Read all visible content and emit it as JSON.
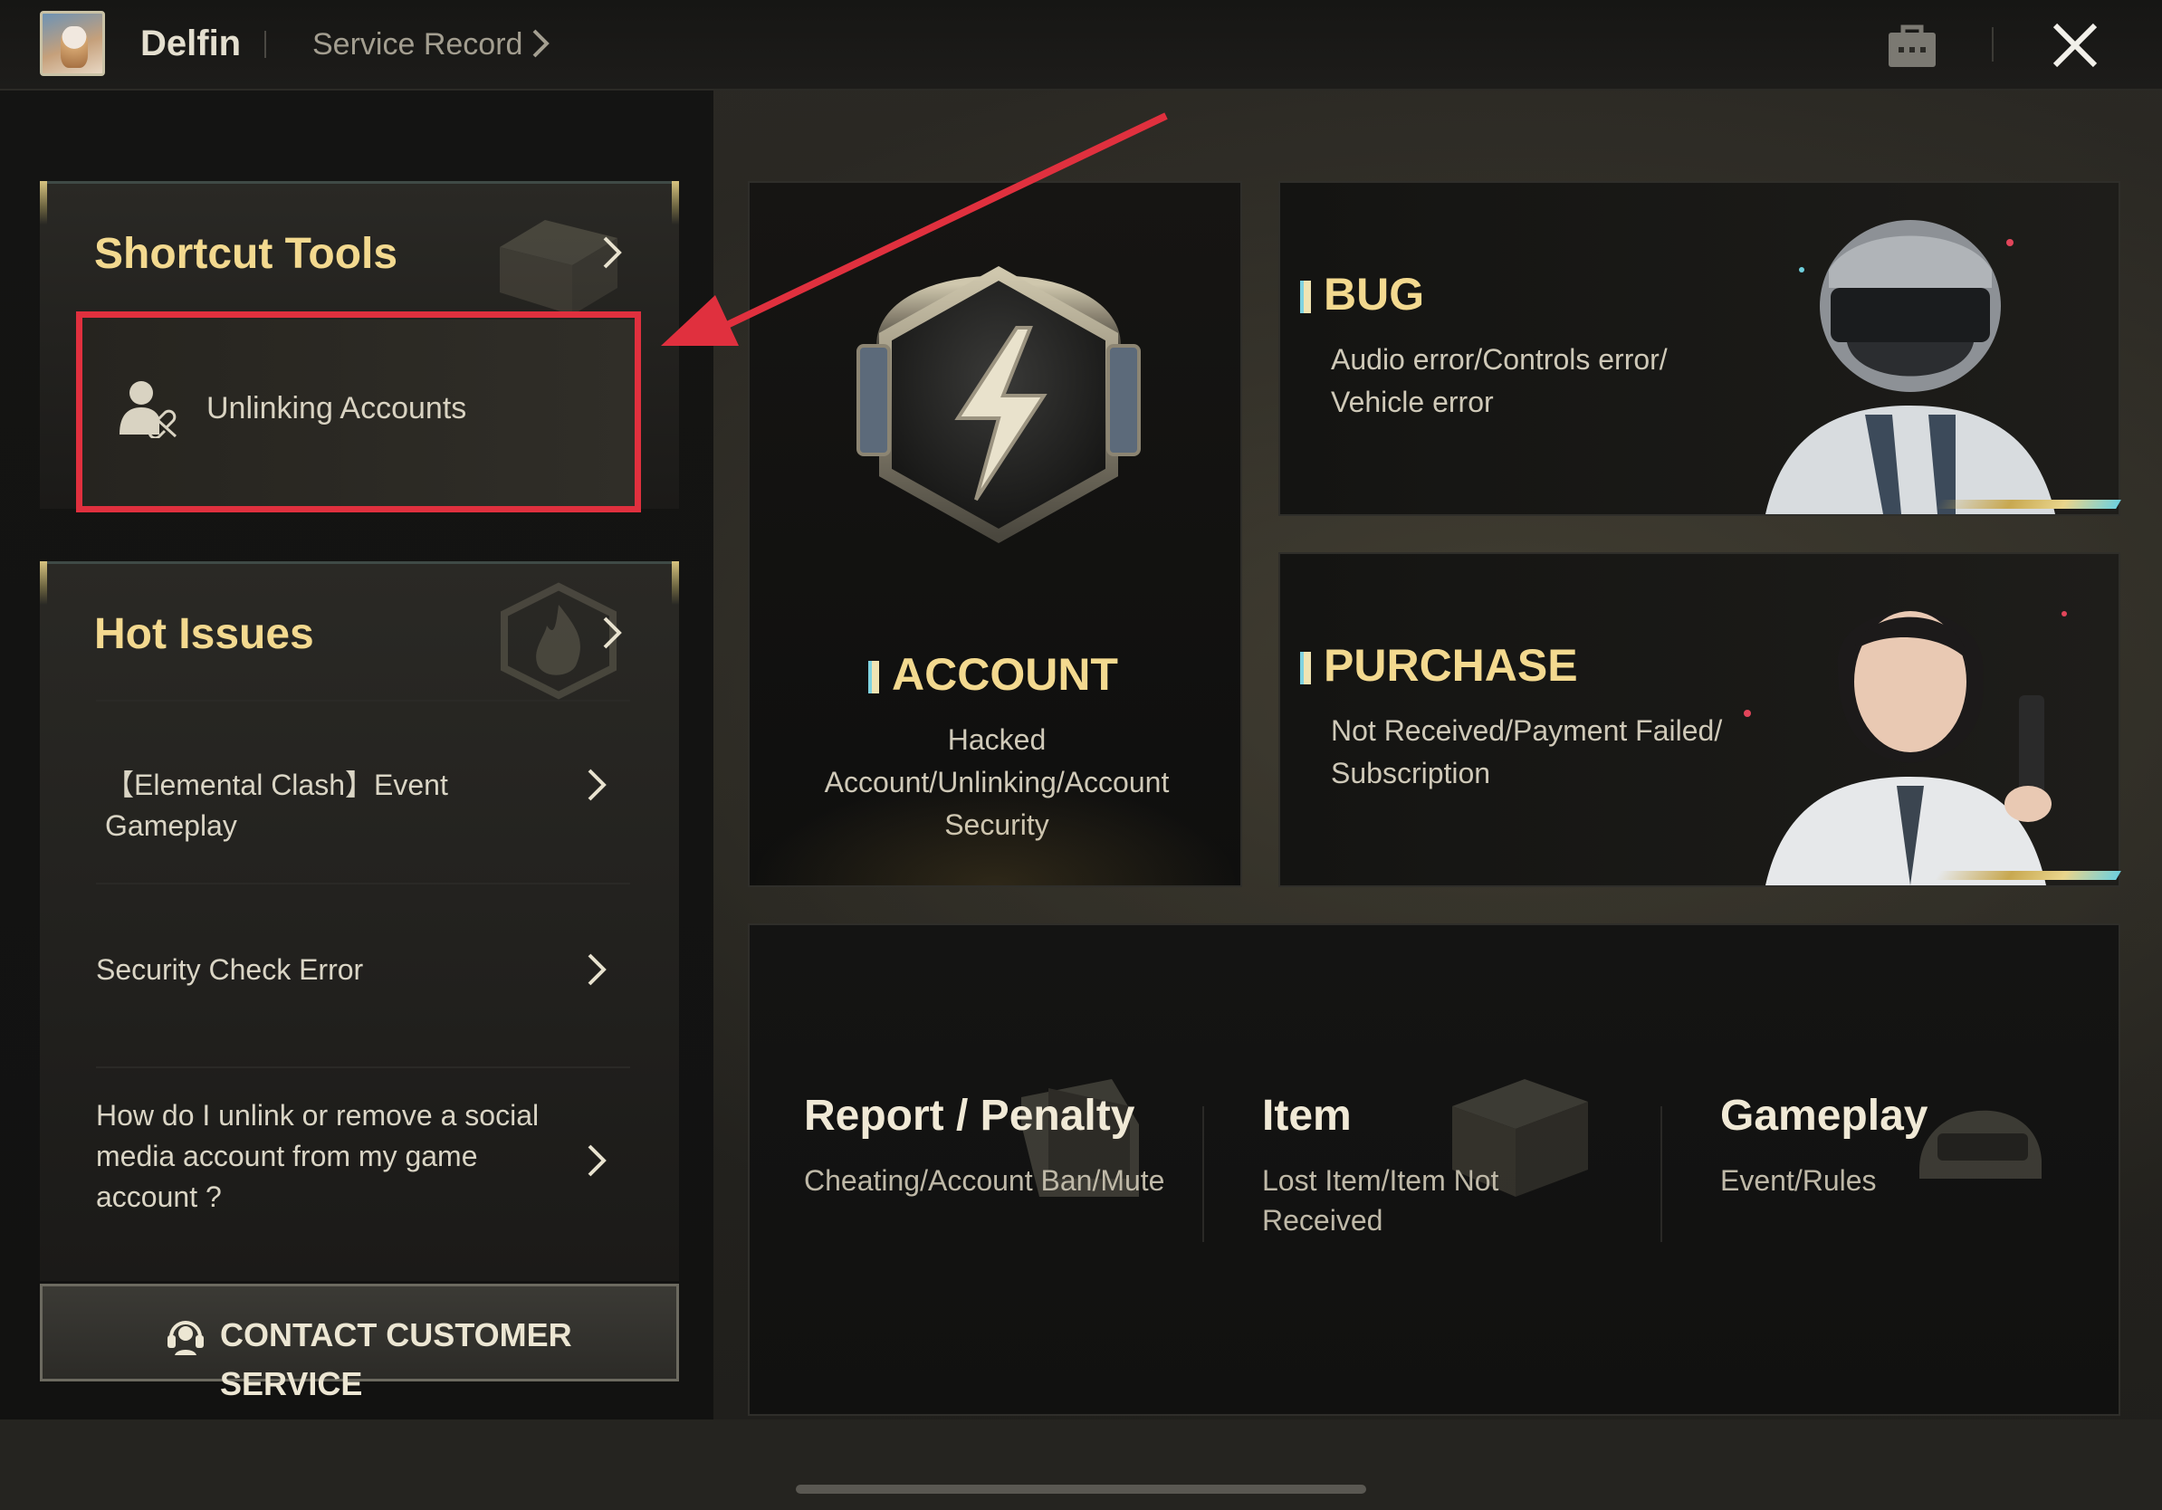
{
  "header": {
    "username": "Delfin",
    "service_record": "Service Record"
  },
  "shortcut_tools": {
    "title": "Shortcut Tools",
    "items": [
      {
        "label": "Unlinking Accounts",
        "icon": "unlink-user-icon"
      }
    ]
  },
  "hot_issues": {
    "title": "Hot Issues",
    "items": [
      {
        "label": "【Elemental Clash】Event Gameplay"
      },
      {
        "label": "Security Check Error"
      },
      {
        "label": "How do I unlink or remove a social media account from my game account ?"
      }
    ]
  },
  "contact": {
    "label": "CONTACT CUSTOMER SERVICE",
    "icon": "headset-icon"
  },
  "tiles": {
    "account": {
      "title": "ACCOUNT",
      "subtitle": "Hacked Account/Unlinking/Account Security"
    },
    "bug": {
      "title": "BUG",
      "subtitle": "Audio error/Controls error/ Vehicle error"
    },
    "purchase": {
      "title": "PURCHASE",
      "subtitle": "Not Received/Payment Failed/ Subscription"
    }
  },
  "categories": [
    {
      "title": "Report / Penalty",
      "subtitle": "Cheating/Account Ban/Mute",
      "icon": "folder-icon"
    },
    {
      "title": "Item",
      "subtitle": "Lost Item/Item Not Received",
      "icon": "crate-icon"
    },
    {
      "title": "Gameplay",
      "subtitle": "Event/Rules",
      "icon": "helmet-icon"
    }
  ],
  "colors": {
    "accent_gold": "#f3d98f",
    "annotation_red": "#e0303e",
    "panel_bg": "#121211"
  }
}
